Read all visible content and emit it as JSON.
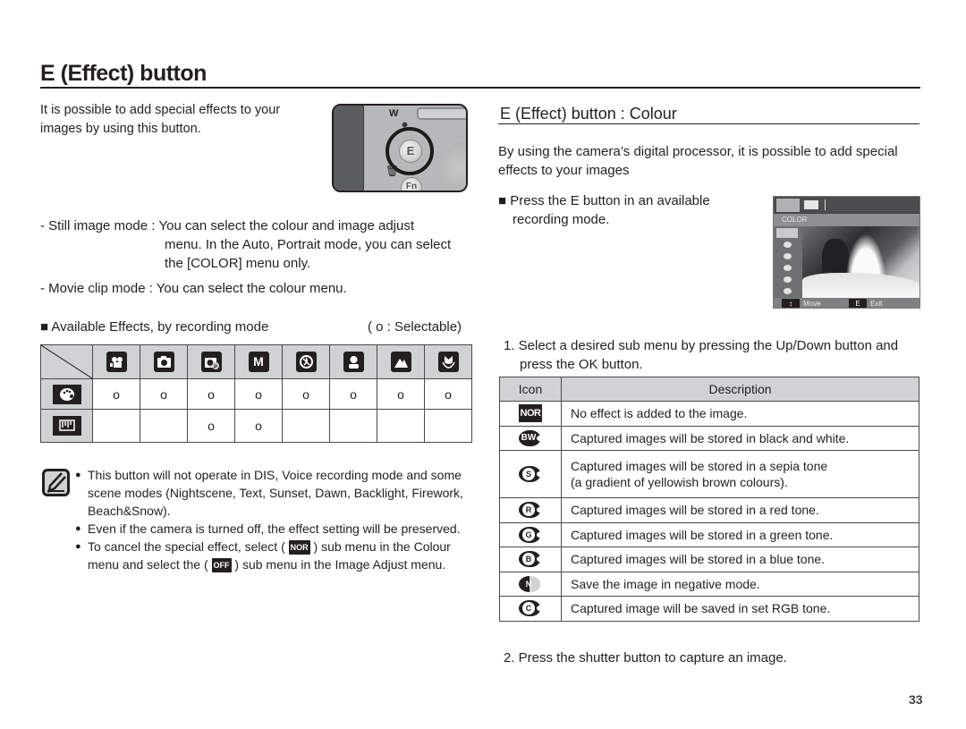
{
  "page": {
    "title": "E (Effect) button",
    "page_number": "33"
  },
  "left": {
    "intro": [
      "It is possible to add special effects to your",
      "images by using this button."
    ],
    "camera_illustration": {
      "w_label": "W",
      "e_label": "E",
      "fn_label": "Fn"
    },
    "still_mode": {
      "label": "- Still image mode : ",
      "lines": [
        "You can select the colour and image adjust",
        "menu. In the Auto, Portrait mode, you can select",
        "the [COLOR] menu only."
      ]
    },
    "movie_mode": "- Movie clip mode : You can select the colour menu.",
    "effects_heading": "■ Available Effects, by recording mode",
    "effects_legend": "( o : Selectable)",
    "effects_table": {
      "columns": [
        "movie-clip-mode",
        "auto-mode",
        "program-mode",
        "manual-mode",
        "dis-mode",
        "portrait-mode",
        "landscape-mode",
        "macro-mode"
      ],
      "rows": [
        {
          "icon": "palette-icon",
          "name": "colour",
          "cells": [
            "o",
            "o",
            "o",
            "o",
            "o",
            "o",
            "o",
            "o"
          ]
        },
        {
          "icon": "image-adjust-icon",
          "name": "image-adjust",
          "cells": [
            "",
            "",
            "o",
            "o",
            "",
            "",
            "",
            ""
          ]
        }
      ]
    },
    "notes": [
      "This button will not operate in DIS, Voice recording mode and some scene modes (Nightscene, Text, Sunset, Dawn, Backlight, Firework, Beach&Snow).",
      "Even if the camera is turned off, the effect setting will be preserved."
    ],
    "cancel_note": {
      "part1": "To cancel the special effect, select (",
      "icon1": "NOR",
      "part2": ") sub menu in the Colour",
      "part3": "menu and select the (",
      "icon2": "OFF",
      "part4": ") sub menu in the Image Adjust menu."
    }
  },
  "right": {
    "subtitle": "E (Effect) button : Colour",
    "intro": [
      "By using the camera’s digital processor, it is possible to add special",
      "effects to your images"
    ],
    "step0": [
      "■ Press the E button in an available",
      "recording mode."
    ],
    "lcd": {
      "menu_label": "COLOR",
      "move_label": "Move",
      "exit_key": "E",
      "exit_label": "Exit",
      "move_key": "↕"
    },
    "step1": [
      "1. Select a desired sub menu by pressing the Up/Down button and",
      "press the OK button."
    ],
    "table": {
      "headers": [
        "Icon",
        "Description"
      ],
      "rows": [
        {
          "icon": "NOR",
          "icon_name": "normal-icon",
          "description": [
            "No effect is added to the image."
          ]
        },
        {
          "icon": "BW",
          "icon_name": "black-white-icon",
          "description": [
            "Captured images will be stored in black and white."
          ]
        },
        {
          "icon": "S",
          "icon_name": "sepia-icon",
          "description": [
            "Captured images will be stored in a sepia tone",
            "(a gradient of yellowish brown colours)."
          ]
        },
        {
          "icon": "R",
          "icon_name": "red-tone-icon",
          "description": [
            "Captured images will be stored in a red tone."
          ]
        },
        {
          "icon": "G",
          "icon_name": "green-tone-icon",
          "description": [
            "Captured images will be stored in a green tone."
          ]
        },
        {
          "icon": "B",
          "icon_name": "blue-tone-icon",
          "description": [
            "Captured images will be stored in a blue tone."
          ]
        },
        {
          "icon": "N",
          "icon_name": "negative-icon",
          "description": [
            "Save the image in negative mode."
          ]
        },
        {
          "icon": "C",
          "icon_name": "custom-rgb-icon",
          "description": [
            "Captured image will be saved in set RGB tone."
          ]
        }
      ]
    },
    "step2": "2. Press the shutter button to capture an image."
  }
}
